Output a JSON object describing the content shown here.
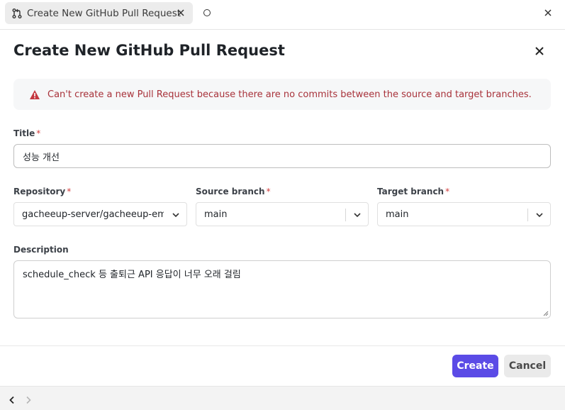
{
  "tab": {
    "title": "Create New GitHub Pull Request",
    "icon": "git-pull-request-icon"
  },
  "dialog": {
    "title": "Create New GitHub Pull Request"
  },
  "alert": {
    "message": "Can't create a new Pull Request because there are no commits between the source and target branches.",
    "icon": "warning-icon",
    "color": "#a8323a"
  },
  "form": {
    "required_mark": "*",
    "title_label": "Title",
    "title_value": "성능 개선",
    "repository_label": "Repository",
    "repository_value": "gacheeup-server/gacheeup-emp",
    "source_branch_label": "Source branch",
    "source_branch_value": "main",
    "target_branch_label": "Target branch",
    "target_branch_value": "main",
    "description_label": "Description",
    "description_value": "schedule_check 등 출퇴근 API 응답이 너무 오래 걸림"
  },
  "buttons": {
    "create": "Create",
    "cancel": "Cancel"
  },
  "colors": {
    "primary": "#5b4be6",
    "error": "#a8323a"
  }
}
